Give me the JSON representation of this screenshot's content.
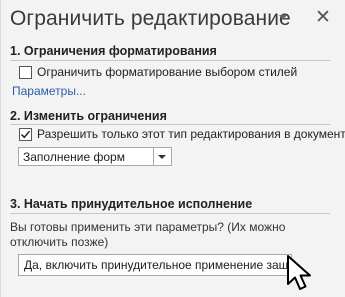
{
  "pane": {
    "title": "Ограничить редактирование",
    "icons": {
      "dropdown": "chevron-down-icon",
      "close": "close-icon"
    }
  },
  "sections": {
    "formatting": {
      "title": "1. Ограничения форматирования",
      "checkbox_label": "Ограничить форматирование выбором стилей",
      "checked": false,
      "link": "Параметры..."
    },
    "editing": {
      "title": "2. Изменить ограничения",
      "checkbox_label": "Разрешить только этот тип редактирования в документе:",
      "checked": true,
      "selected_option": "Заполнение форм"
    },
    "enforcement": {
      "title": "3. Начать принудительное исполнение",
      "description": "Вы готовы применить эти параметры? (Их можно отключить позже)",
      "button_label": "Да, включить принудительное применение защиты"
    }
  },
  "colors": {
    "link": "#2e5ea8",
    "title": "#3a3a3a"
  }
}
